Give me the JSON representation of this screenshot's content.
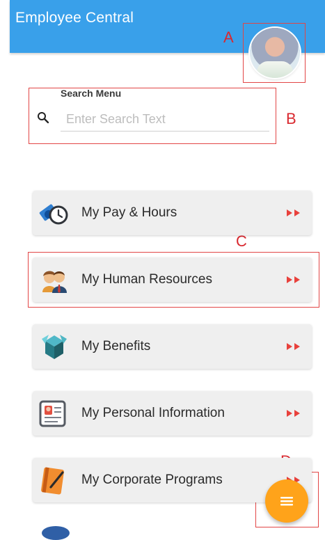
{
  "header": {
    "title": "Employee Central",
    "avatar_icon": "profile-avatar"
  },
  "search": {
    "label": "Search Menu",
    "placeholder": "Enter Search Text",
    "icon": "search-icon"
  },
  "menu": {
    "items": [
      {
        "label": "My Pay & Hours",
        "icon": "money-clock-icon"
      },
      {
        "label": "My Human Resources",
        "icon": "people-icon"
      },
      {
        "label": "My Benefits",
        "icon": "gift-box-icon"
      },
      {
        "label": "My Personal Information",
        "icon": "id-card-icon"
      },
      {
        "label": "My Corporate Programs",
        "icon": "notebook-pen-icon"
      }
    ],
    "arrow_icon": "double-chevron-right-icon"
  },
  "annotations": [
    "A",
    "B",
    "C",
    "D"
  ],
  "fab": {
    "icon": "menu-icon"
  },
  "colors": {
    "appbar": "#39a0ea",
    "arrow": "#e8413c",
    "fab": "#ffa31a",
    "annotation": "#d9282f"
  }
}
